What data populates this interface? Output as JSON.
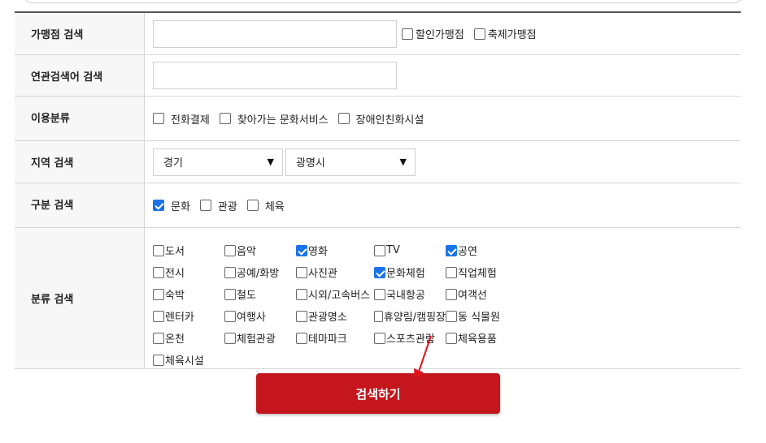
{
  "rows": {
    "store_search": {
      "label": "가맹점 검색",
      "input_value": "",
      "options": [
        {
          "label": "할인가맹점",
          "checked": false
        },
        {
          "label": "축제가맹점",
          "checked": false
        }
      ]
    },
    "keyword_search": {
      "label": "연관검색어 검색",
      "input_value": ""
    },
    "usage_type": {
      "label": "이용분류",
      "options": [
        {
          "label": "전화결제",
          "checked": false
        },
        {
          "label": "찾아가는 문화서비스",
          "checked": false
        },
        {
          "label": "장애인친화시설",
          "checked": false
        }
      ]
    },
    "region": {
      "label": "지역 검색",
      "province": "경기",
      "city": "광명시"
    },
    "category": {
      "label": "구분 검색",
      "options": [
        {
          "label": "문화",
          "checked": true
        },
        {
          "label": "관광",
          "checked": false
        },
        {
          "label": "체육",
          "checked": false
        }
      ]
    },
    "classification": {
      "label": "분류 검색",
      "items": [
        {
          "label": "도서",
          "checked": false
        },
        {
          "label": "음악",
          "checked": false
        },
        {
          "label": "영화",
          "checked": true
        },
        {
          "label": "TV",
          "checked": false
        },
        {
          "label": "공연",
          "checked": true
        },
        {
          "label": "전시",
          "checked": false
        },
        {
          "label": "공예/화방",
          "checked": false
        },
        {
          "label": "사진관",
          "checked": false
        },
        {
          "label": "문화체험",
          "checked": true
        },
        {
          "label": "직업체험",
          "checked": false
        },
        {
          "label": "숙박",
          "checked": false
        },
        {
          "label": "철도",
          "checked": false
        },
        {
          "label": "시외/고속버스",
          "checked": false
        },
        {
          "label": "국내항공",
          "checked": false
        },
        {
          "label": "여객선",
          "checked": false
        },
        {
          "label": "렌터카",
          "checked": false
        },
        {
          "label": "여행사",
          "checked": false
        },
        {
          "label": "관광명소",
          "checked": false
        },
        {
          "label": "휴양림/캠핑장",
          "checked": false
        },
        {
          "label": "동 식물원",
          "checked": false
        },
        {
          "label": "온천",
          "checked": false
        },
        {
          "label": "체험관광",
          "checked": false
        },
        {
          "label": "테마파크",
          "checked": false
        },
        {
          "label": "스포츠관람",
          "checked": false
        },
        {
          "label": "체육용품",
          "checked": false
        },
        {
          "label": "체육시설",
          "checked": false
        }
      ]
    }
  },
  "search_button": {
    "label": "검색하기"
  },
  "colors": {
    "accent": "#c4161c",
    "checkbox_on": "#1a73e8",
    "annotation_arrow": "#e0141e"
  }
}
